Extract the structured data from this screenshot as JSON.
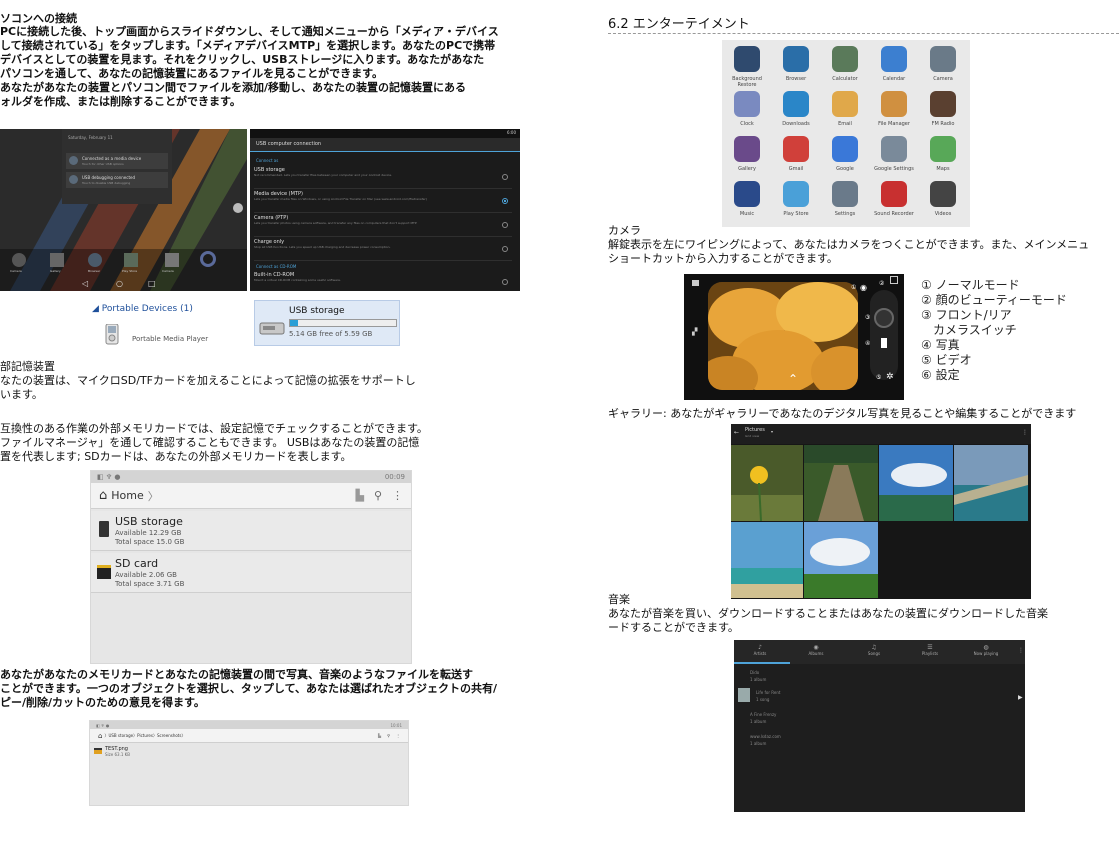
{
  "left": {
    "pc_heading": "ソコンへの接続",
    "pc_lines": [
      "PCに接続した後、トップ画面からスライドダウンし、そして通知メニューから「メディア・デバイス",
      "して接続されている」をタップします。「メディアデバイスMTP」を選択します。あなたのPCで携帯",
      "デバイスとしての装置を見ます。それをクリックし、USBストレージに入ります。あなたがあなた",
      "パソコンを通して、あなたの記憶装置にあるファイルを見ることができます。",
      "あなたがあなたの装置とパソコン間でファイルを添加/移動し、あなたの装置の記憶装置にある",
      "ォルダを作成、または削除することができます。"
    ],
    "lock_screen": {
      "date": "Saturday, February 11",
      "notif1_title": "Connected as a media device",
      "notif1_sub": "Touch for other USB options",
      "notif2_title": "USB debugging connected",
      "notif2_sub": "Touch to disable USB debugging",
      "dock": [
        "Camera",
        "Gallery",
        "Browser",
        "Play Store",
        "Camera"
      ]
    },
    "usb_settings": {
      "status": "6:00",
      "title": "USB computer connection",
      "section": "Connect as",
      "options": [
        {
          "title": "USB storage",
          "sub": "Not recommended. Lets you transfer files between your computer and your Android device.",
          "selected": false
        },
        {
          "title": "Media device (MTP)",
          "sub": "Lets you transfer media files on Windows, or using Android File Transfer on Mac (see www.android.com/filetransfer)",
          "selected": true
        },
        {
          "title": "Camera (PTP)",
          "sub": "Lets you transfer photos using camera software, and transfer any files on computers that don't support MTP",
          "selected": false
        },
        {
          "title": "Charge only",
          "sub": "Stop all USB functions. Lets you speed up USB charging and decrease power consumption.",
          "selected": false
        }
      ],
      "section2": "Connect as CD-ROM",
      "option5_title": "Built-in CD-ROM",
      "option5_sub": "Mount a virtual CD-ROM containing some useful software.",
      "option5_selected": false
    },
    "portable": {
      "header": "Portable Devices (1)",
      "device": "Portable Media Player",
      "storage_name": "USB storage",
      "storage_free": "5.14 GB free of 5.59 GB",
      "storage_used_fraction": 0.08
    },
    "ext_heading": "部記憶装置",
    "ext_lines1": [
      "なたの装置は、マイクロSD/TFカードを加えることによって記憶の拡張をサポートし",
      "います。"
    ],
    "ext_lines2": [
      "互換性のある作業の外部メモリカードでは、設定記憶でチェックすることができます。",
      "ファイルマネージャ」を通して確認することもできます。 USBはあなたの装置の記憶",
      "置を代表します; SDカードは、あなたの外部メモリカードを表します。"
    ],
    "file_manager": {
      "status_time": "00:09",
      "home_label": "Home",
      "items": [
        {
          "name": "USB storage",
          "available": "Available 12.29 GB",
          "total": "Total space 15.0 GB"
        },
        {
          "name": "SD card",
          "available": "Available 2.06 GB",
          "total": "Total space 3.71 GB"
        }
      ]
    },
    "transfer_lines": [
      "あなたがあなたのメモリカードとあなたの記憶装置の間で写真、音楽のようなファイルを転送す",
      "ことができます。一つのオブジェクトを選択し、タップして、あなたは選ばれたオブジェクトの共有/",
      "ピー/削除/カットのための意見を得ます。"
    ],
    "small_fm": {
      "status_time": "10:01",
      "crumbs": [
        "USB storage",
        "Pictures",
        "Screenshots"
      ],
      "file_name": "TEST.png",
      "file_size": "Size 63.1 KB"
    }
  },
  "right": {
    "section_title": "6.2 エンターテイメント",
    "apps": [
      {
        "label": "Background Restore",
        "color": "#2f4a6e"
      },
      {
        "label": "Browser",
        "color": "#2a6ea8"
      },
      {
        "label": "Calculator",
        "color": "#5a7a5a"
      },
      {
        "label": "Calendar",
        "color": "#3c7fd0"
      },
      {
        "label": "Camera",
        "color": "#6a7a88"
      },
      {
        "label": "Clock",
        "color": "#7a8ac0"
      },
      {
        "label": "Downloads",
        "color": "#2a86c8"
      },
      {
        "label": "Email",
        "color": "#e0a84a"
      },
      {
        "label": "File Manager",
        "color": "#d09040"
      },
      {
        "label": "FM Radio",
        "color": "#5a4030"
      },
      {
        "label": "Gallery",
        "color": "#6a4a8a"
      },
      {
        "label": "Gmail",
        "color": "#d0403a"
      },
      {
        "label": "Google",
        "color": "#3a78d8"
      },
      {
        "label": "Google Settings",
        "color": "#7a8a9a"
      },
      {
        "label": "Maps",
        "color": "#58a858"
      },
      {
        "label": "Music",
        "color": "#2a4a8a"
      },
      {
        "label": "Play Store",
        "color": "#4aa0d8"
      },
      {
        "label": "Settings",
        "color": "#6a7a8a"
      },
      {
        "label": "Sound Recorder",
        "color": "#c83030"
      },
      {
        "label": "Videos",
        "color": "#444444"
      }
    ],
    "camera_heading": "カメラ",
    "camera_lines": [
      "解錠表示を左にワイピングによって、あなたはカメラをつくことができます。また、メインメニュ",
      "ショートカットから入力することができます。"
    ],
    "camera_labels": [
      "① ノーマルモード",
      "② 顔のビューティーモード",
      "③ フロント/リア",
      "　カメラスイッチ",
      "④ 写真",
      "⑤ ビデオ",
      "⑥ 設定"
    ],
    "camera_markers": [
      "①",
      "②",
      "③",
      "④",
      "⑤",
      "⑥"
    ],
    "gallery_line": "ギャラリー: あなたがギャラリーであなたのデジタル写真を見ることや編集することができます",
    "gallery_header": "Pictures",
    "gallery_sub": "Grid view",
    "music_heading": "音楽",
    "music_lines": [
      "あなたが音楽を買い、ダウンロードすることまたはあなたの装置にダウンロードした音楽",
      "ードすることができます。"
    ],
    "music_tabs": [
      "Artists",
      "Albums",
      "Songs",
      "Playlists",
      "Now playing"
    ],
    "music_items": [
      {
        "name": "Dido",
        "sub": "1 album"
      },
      {
        "name": "Life for Rent",
        "sub": "1 song"
      },
      {
        "name": "A Fine Frenzy",
        "sub": "1 album"
      },
      {
        "name": "www.lsdaz.com",
        "sub": "1 album"
      }
    ]
  }
}
